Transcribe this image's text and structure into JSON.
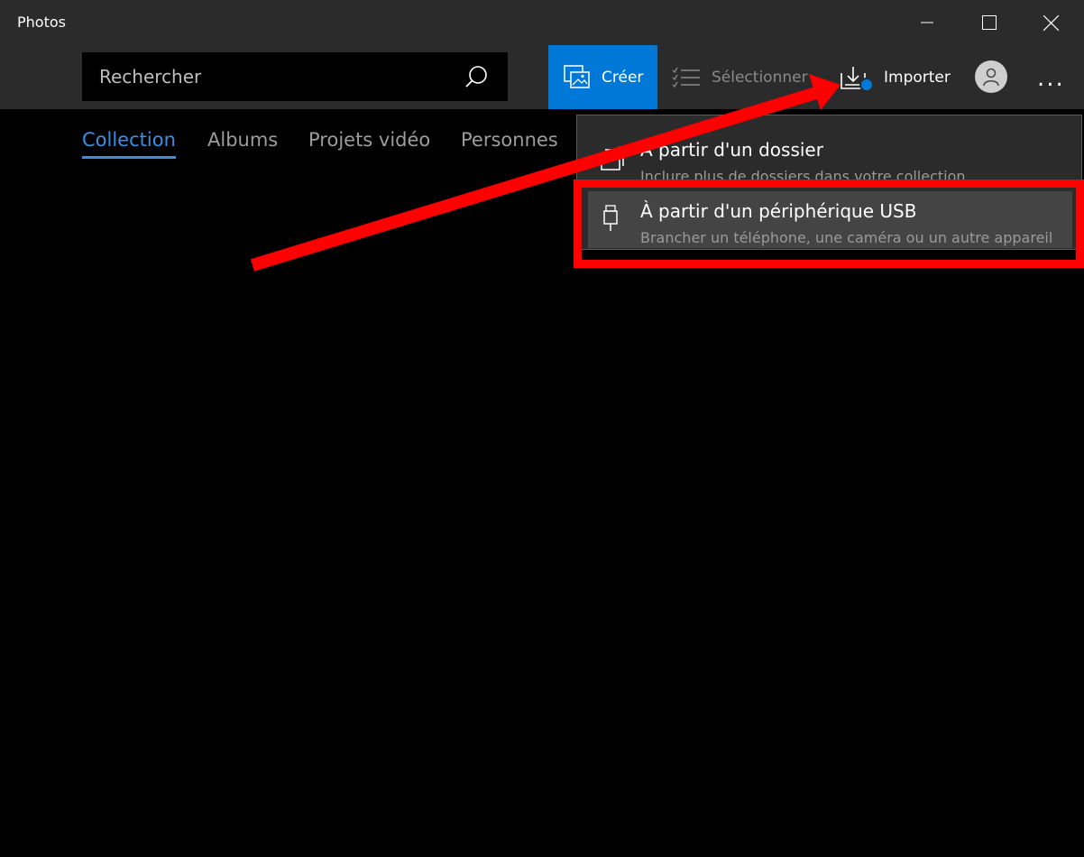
{
  "window": {
    "title": "Photos",
    "controls": [
      "minimize",
      "maximize",
      "close"
    ]
  },
  "toolbar": {
    "search_placeholder": "Rechercher",
    "create_label": "Créer",
    "select_label": "Sélectionner",
    "import_label": "Importer",
    "more_label": "...",
    "accent_color": "#0078d7"
  },
  "tabs": [
    {
      "label": "Collection",
      "active": true
    },
    {
      "label": "Albums",
      "active": false
    },
    {
      "label": "Projets vidéo",
      "active": false
    },
    {
      "label": "Personnes",
      "active": false
    }
  ],
  "import_menu": {
    "items": [
      {
        "title": "À partir d'un dossier",
        "subtitle": "Inclure plus de dossiers dans votre collection",
        "icon": "folder-icon"
      },
      {
        "title": "À partir d'un périphérique USB",
        "subtitle": "Brancher un téléphone, une caméra ou un autre appareil",
        "icon": "usb-icon",
        "highlighted": true
      }
    ]
  },
  "annotation": {
    "arrow_color": "#ff0000",
    "box_color": "#ff0000"
  }
}
